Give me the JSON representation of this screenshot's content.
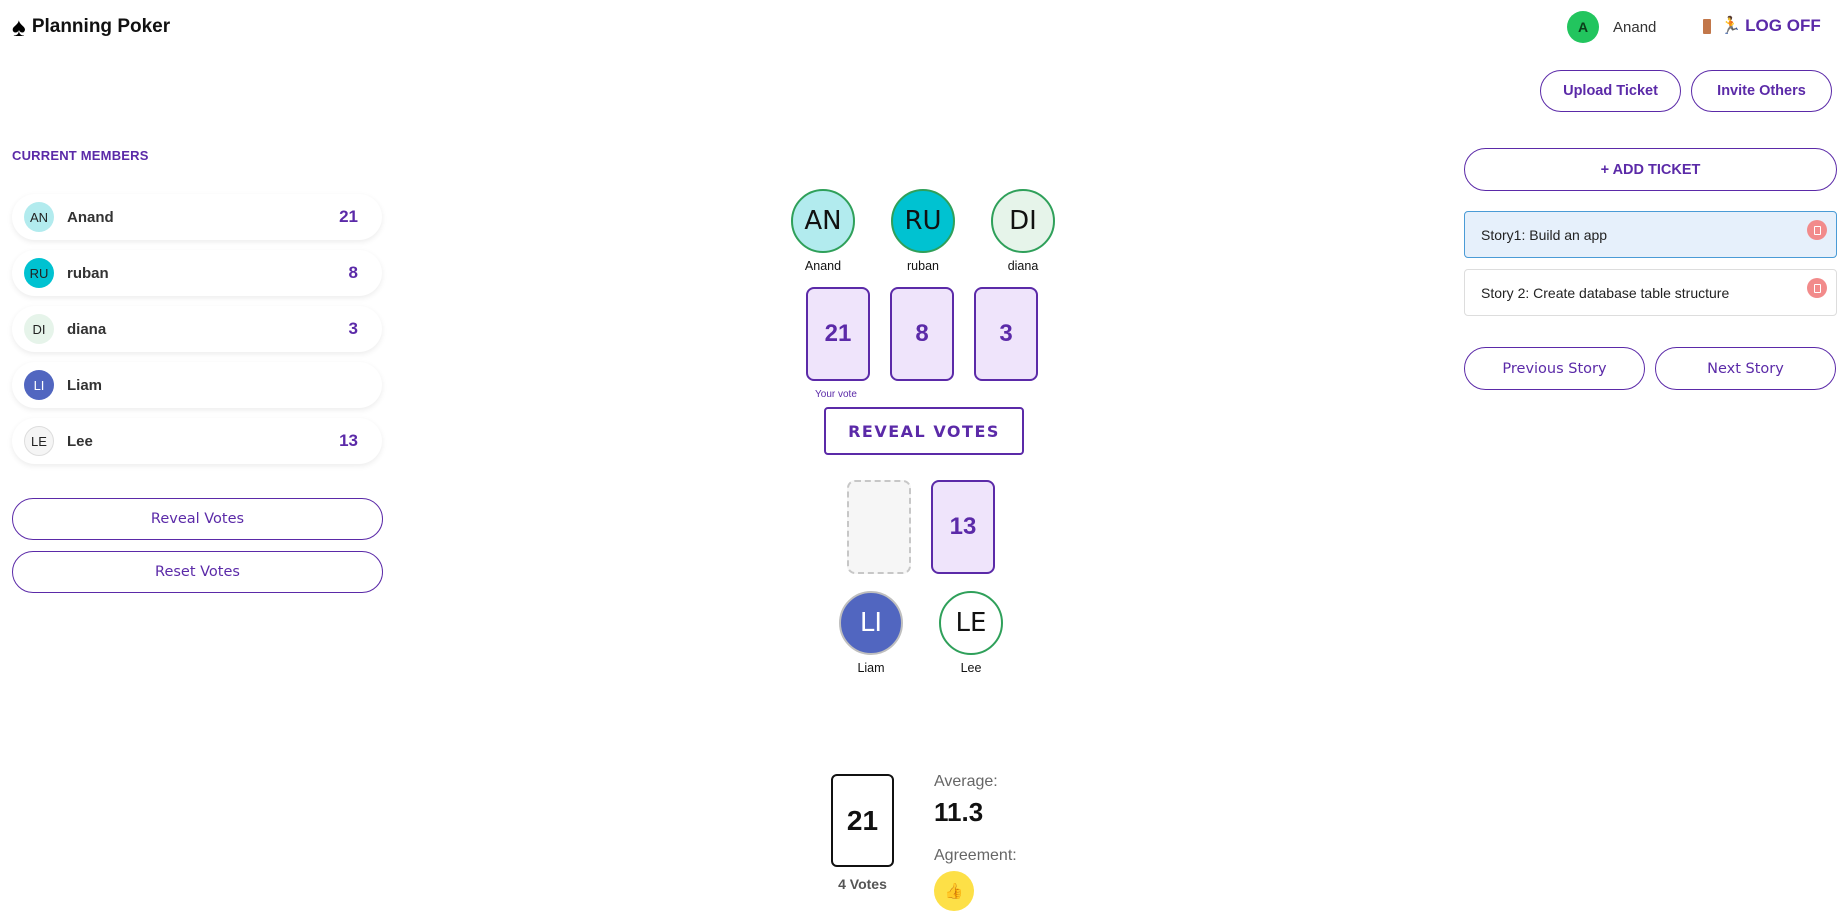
{
  "header": {
    "app_title": "Planning Poker",
    "logo_icon": "spade-icon",
    "user": {
      "initial": "A",
      "name": "Anand",
      "color": "#22c55e"
    },
    "logoff_label": "LOG OFF",
    "upload_label": "Upload Ticket",
    "invite_label": "Invite Others"
  },
  "sidebar": {
    "heading": "CURRENT MEMBERS",
    "members": [
      {
        "initials": "AN",
        "name": "Anand",
        "vote": "21",
        "color": "#b2ebee"
      },
      {
        "initials": "RU",
        "name": "ruban",
        "vote": "8",
        "color": "#00c2d1"
      },
      {
        "initials": "DI",
        "name": "diana",
        "vote": "3",
        "color": "#e6f4ea"
      },
      {
        "initials": "LI",
        "name": "Liam",
        "vote": "",
        "color": "#5166c0"
      },
      {
        "initials": "LE",
        "name": "Lee",
        "vote": "13",
        "color": "#f5f5f5"
      }
    ],
    "reveal_label": "Reveal Votes",
    "reset_label": "Reset Votes"
  },
  "table": {
    "top_players": [
      {
        "initials": "AN",
        "name": "Anand",
        "vote": "21"
      },
      {
        "initials": "RU",
        "name": "ruban",
        "vote": "8"
      },
      {
        "initials": "DI",
        "name": "diana",
        "vote": "3"
      }
    ],
    "bottom_players": [
      {
        "initials": "LI",
        "name": "Liam",
        "vote": ""
      },
      {
        "initials": "LE",
        "name": "Lee",
        "vote": "13"
      }
    ],
    "your_vote_label": "Your vote",
    "reveal_button": "REVEAL VOTES"
  },
  "results": {
    "top_card": "21",
    "votes_count": "4 Votes",
    "average_label": "Average:",
    "average_value": "11.3",
    "agreement_label": "Agreement:",
    "agreement_icon": "thumbs-icon"
  },
  "tickets": {
    "add_label": "+ ADD TICKET",
    "items": [
      {
        "title": "Story1: Build an app",
        "active": true
      },
      {
        "title": "Story 2: Create database table structure",
        "active": false
      }
    ],
    "previous_label": "Previous Story",
    "next_label": "Next Story"
  }
}
